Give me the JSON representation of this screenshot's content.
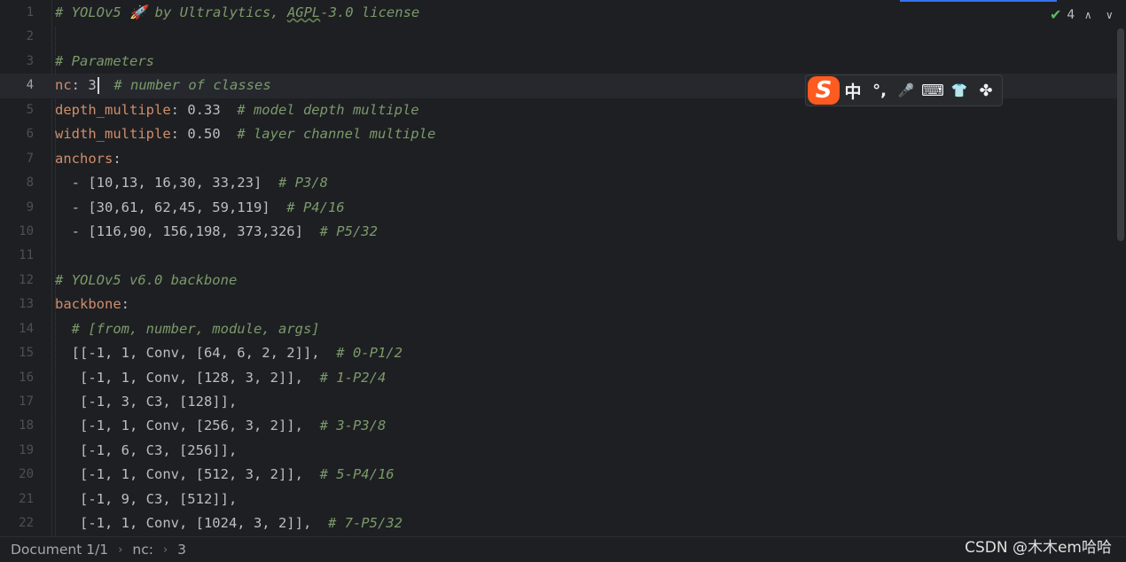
{
  "inspection": {
    "problem_count": "4",
    "check_icon": "✔",
    "up_icon": "∧",
    "down_icon": "∨"
  },
  "ime": {
    "logo": "S",
    "mode": "中",
    "punct": "°,",
    "voice_icon": "🎤",
    "keyboard_icon": "⌨",
    "skin_icon": "👕",
    "toolbox_icon": "✤"
  },
  "editor": {
    "current_line": 4,
    "lines": [
      {
        "n": "1",
        "parts": [
          {
            "t": "c",
            "v": "# YOLOv5 🚀 by Ultralytics, "
          },
          {
            "t": "cs",
            "v": "AGPL"
          },
          {
            "t": "c",
            "v": "-3.0 license"
          }
        ]
      },
      {
        "n": "2",
        "parts": []
      },
      {
        "n": "3",
        "parts": [
          {
            "t": "c",
            "v": "# Parameters"
          }
        ]
      },
      {
        "n": "4",
        "parts": [
          {
            "t": "k",
            "v": "nc"
          },
          {
            "t": "p",
            "v": ": 3"
          },
          {
            "t": "caret",
            "v": ""
          },
          {
            "t": "p",
            "v": "  "
          },
          {
            "t": "c",
            "v": "# number of classes"
          }
        ]
      },
      {
        "n": "5",
        "parts": [
          {
            "t": "k",
            "v": "depth_multiple"
          },
          {
            "t": "p",
            "v": ": 0.33  "
          },
          {
            "t": "c",
            "v": "# model depth multiple"
          }
        ]
      },
      {
        "n": "6",
        "parts": [
          {
            "t": "k",
            "v": "width_multiple"
          },
          {
            "t": "p",
            "v": ": 0.50  "
          },
          {
            "t": "c",
            "v": "# layer channel multiple"
          }
        ]
      },
      {
        "n": "7",
        "parts": [
          {
            "t": "k",
            "v": "anchors"
          },
          {
            "t": "p",
            "v": ":"
          }
        ]
      },
      {
        "n": "8",
        "parts": [
          {
            "t": "p",
            "v": "  - [10,13, 16,30, 33,23]  "
          },
          {
            "t": "c",
            "v": "# P3/8"
          }
        ]
      },
      {
        "n": "9",
        "parts": [
          {
            "t": "p",
            "v": "  - [30,61, 62,45, 59,119]  "
          },
          {
            "t": "c",
            "v": "# P4/16"
          }
        ]
      },
      {
        "n": "10",
        "parts": [
          {
            "t": "p",
            "v": "  - [116,90, 156,198, 373,326]  "
          },
          {
            "t": "c",
            "v": "# P5/32"
          }
        ]
      },
      {
        "n": "11",
        "parts": []
      },
      {
        "n": "12",
        "parts": [
          {
            "t": "c",
            "v": "# YOLOv5 v6.0 backbone"
          }
        ]
      },
      {
        "n": "13",
        "parts": [
          {
            "t": "k",
            "v": "backbone"
          },
          {
            "t": "p",
            "v": ":"
          }
        ]
      },
      {
        "n": "14",
        "parts": [
          {
            "t": "p",
            "v": "  "
          },
          {
            "t": "c",
            "v": "# [from, number, module, args]"
          }
        ]
      },
      {
        "n": "15",
        "parts": [
          {
            "t": "p",
            "v": "  [[-1, 1, Conv, [64, 6, 2, 2]],  "
          },
          {
            "t": "c",
            "v": "# 0-P1/2"
          }
        ]
      },
      {
        "n": "16",
        "parts": [
          {
            "t": "p",
            "v": "   [-1, 1, Conv, [128, 3, 2]],  "
          },
          {
            "t": "c",
            "v": "# 1-P2/4"
          }
        ]
      },
      {
        "n": "17",
        "parts": [
          {
            "t": "p",
            "v": "   [-1, 3, C3, [128]],"
          }
        ]
      },
      {
        "n": "18",
        "parts": [
          {
            "t": "p",
            "v": "   [-1, 1, Conv, [256, 3, 2]],  "
          },
          {
            "t": "c",
            "v": "# 3-P3/8"
          }
        ]
      },
      {
        "n": "19",
        "parts": [
          {
            "t": "p",
            "v": "   [-1, 6, C3, [256]],"
          }
        ]
      },
      {
        "n": "20",
        "parts": [
          {
            "t": "p",
            "v": "   [-1, 1, Conv, [512, 3, 2]],  "
          },
          {
            "t": "c",
            "v": "# 5-P4/16"
          }
        ]
      },
      {
        "n": "21",
        "parts": [
          {
            "t": "p",
            "v": "   [-1, 9, C3, [512]],"
          }
        ]
      },
      {
        "n": "22",
        "parts": [
          {
            "t": "p",
            "v": "   [-1, 1, Conv, [1024, 3, 2]],  "
          },
          {
            "t": "c",
            "v": "# 7-P5/32"
          }
        ]
      }
    ]
  },
  "statusbar": {
    "crumbs": [
      "Document 1/1",
      "nc:",
      "3"
    ],
    "separator": "›"
  },
  "watermark": "CSDN @木木em哈哈",
  "colors": {
    "background": "#1e1f22",
    "key": "#cf8e6d",
    "comment": "#7a9a6b",
    "plain": "#bcbec4",
    "ime_logo": "#ff5a1f",
    "accent": "#3574f0"
  }
}
